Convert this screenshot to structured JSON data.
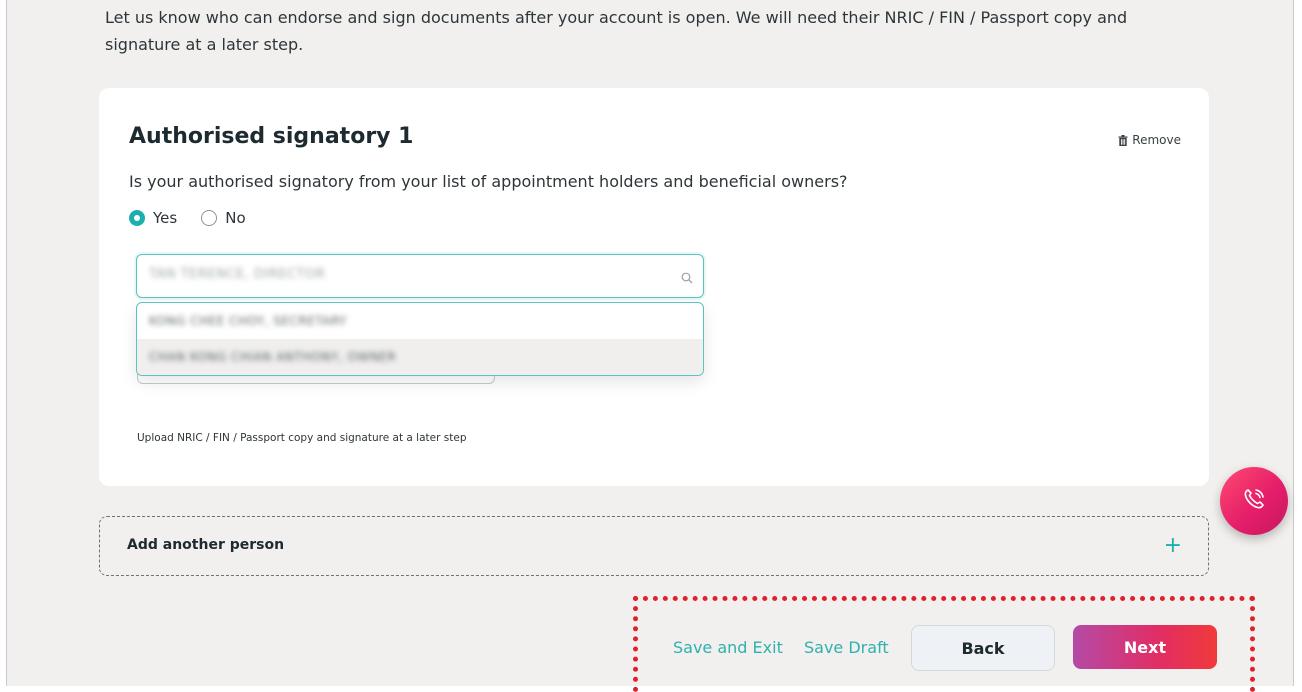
{
  "intro": {
    "line1": "Let us know who can endorse and sign documents after your account is open. We will need their NRIC / FIN / Passport copy and",
    "line2": "signature at a later step."
  },
  "signatory_card": {
    "title": "Authorised signatory 1",
    "remove_label": "Remove",
    "remove_icon": "trash-icon",
    "question": "Is your authorised signatory from your list of appointment holders and beneficial owners?",
    "options": [
      {
        "label": "Yes",
        "selected": true
      },
      {
        "label": "No",
        "selected": false
      }
    ],
    "search": {
      "value": "TAN TERENCE, DIRECTOR",
      "icon": "search-icon"
    },
    "dropdown_options": [
      "KONG CHEE CHOY, SECRETARY",
      "CHAN KONG CHIAN ANTHONY, OWNER"
    ],
    "upload_note": "Upload NRIC / FIN / Passport copy and signature at a later step"
  },
  "add_person": {
    "label": "Add another person",
    "icon": "plus-icon",
    "icon_glyph": "+"
  },
  "actions": {
    "save_exit": "Save and Exit",
    "save_draft": "Save Draft",
    "back": "Back",
    "next": "Next"
  },
  "fab": {
    "icon": "phone-call-icon"
  },
  "colors": {
    "accent_teal": "#1bb0ad",
    "highlight_red": "#e2202a",
    "next_gradient_start": "#b44aa6",
    "next_gradient_end": "#f03a3a",
    "fab_pink": "#e61e6a",
    "page_bg": "#f1f0ef"
  }
}
